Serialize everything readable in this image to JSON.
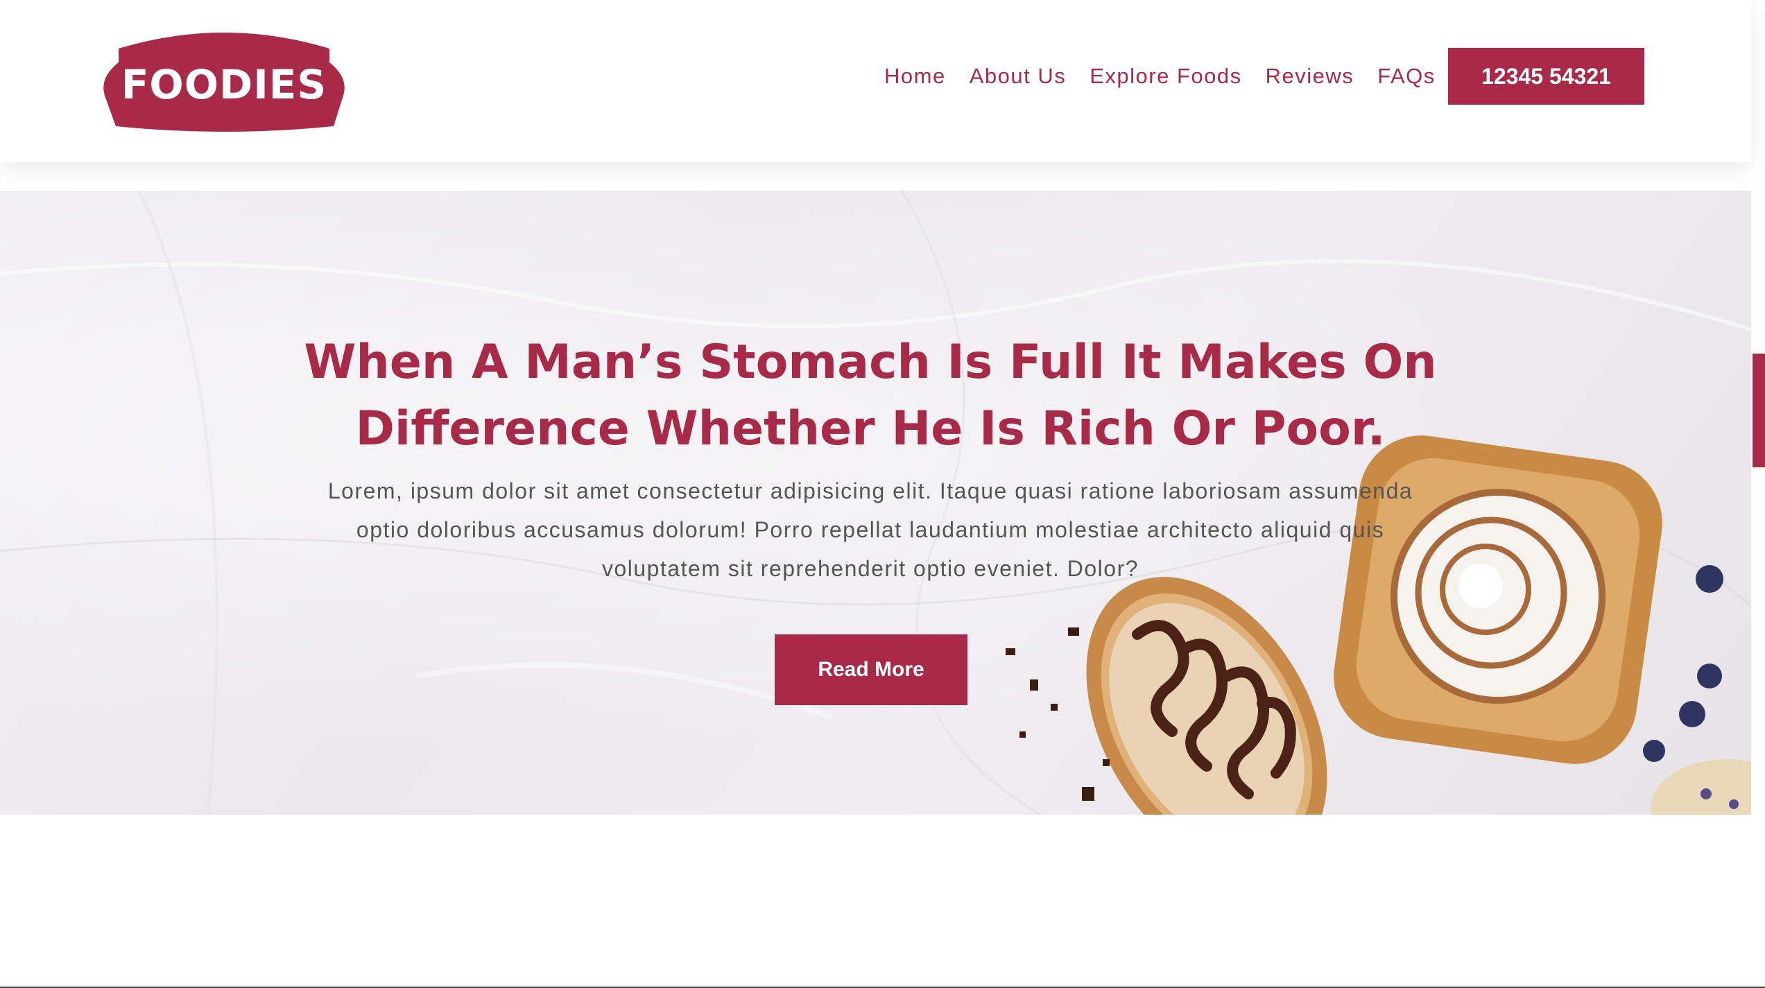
{
  "brand": {
    "logo_text": "FOODIES",
    "accent_color": "#a82a48"
  },
  "nav": {
    "items": [
      {
        "label": "Home"
      },
      {
        "label": "About Us"
      },
      {
        "label": "Explore Foods"
      },
      {
        "label": "Reviews"
      },
      {
        "label": "FAQs"
      }
    ],
    "phone_label": "12345 54321"
  },
  "hero": {
    "title": "When A Man’s Stomach Is Full It Makes On Difference Whether He Is Rich Or Poor.",
    "text": "Lorem, ipsum dolor sit amet consectetur adipisicing elit. Itaque quasi ratione laboriosam assumenda optio doloribus accusamus dolorum! Porro repellat laudantium molestiae architecto aliquid quis voluptatem sit reprehenderit optio eveniet. Dolor?",
    "button_label": "Read More",
    "image_icon": "pastries-image"
  },
  "side_tab": {
    "icon": "side-tab-icon"
  }
}
